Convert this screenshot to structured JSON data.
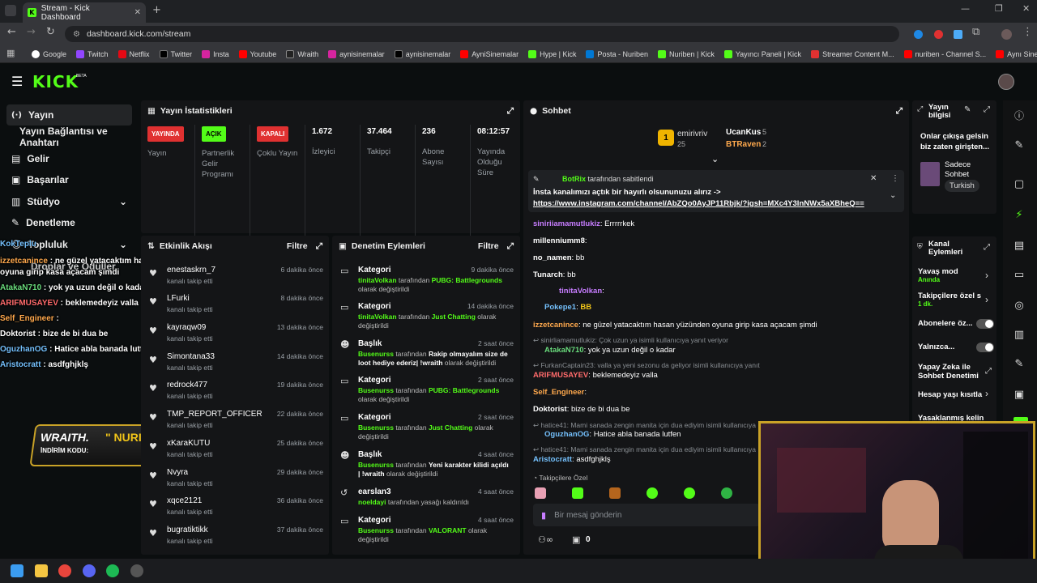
{
  "browser": {
    "tab_title": "Stream - Kick Dashboard",
    "url": "dashboard.kick.com/stream",
    "bookmarks": [
      "Google",
      "Twitch",
      "Netflix",
      "Twitter",
      "Insta",
      "Youtube",
      "Wraith",
      "aynisinemalar",
      "aynisinemalar",
      "AyniSinemalar",
      "Hype | Kick",
      "Posta - Nuriben",
      "Nuriben | Kick",
      "Yayıncı Paneli | Kick",
      "Streamer Content M...",
      "nuriben - Channel S...",
      "Aynı Sinemalar - Ça..."
    ]
  },
  "header": {
    "logo": "KICK",
    "beta": "BETA"
  },
  "sidebar": {
    "items": [
      {
        "label": "Yayın",
        "icon": "broadcast-icon"
      },
      {
        "label": "Yayın Bağlantısı ve Anahtarı"
      },
      {
        "label": "Gelir",
        "icon": "revenue-icon"
      },
      {
        "label": "Başarılar",
        "icon": "trophy-icon"
      },
      {
        "label": "Stüdyo",
        "icon": "studio-icon"
      },
      {
        "label": "Denetleme",
        "icon": "wrench-icon"
      },
      {
        "label": "Topluluk",
        "icon": "community-icon"
      },
      {
        "label": "Droplar ve Ödüller"
      }
    ]
  },
  "stats": {
    "title": "Yayın İstatistikleri",
    "items": [
      {
        "badge": "YAYINDA",
        "label": "Yayın",
        "color": "#e03131"
      },
      {
        "badge": "AÇIK",
        "label": "Partnerlik Gelir Programı",
        "color": "#53fc18"
      },
      {
        "badge": "KAPALI",
        "label": "Çoklu Yayın",
        "color": "#e03131"
      },
      {
        "value": "1.672",
        "label": "İzleyici"
      },
      {
        "value": "37.464",
        "label": "Takipçi"
      },
      {
        "value": "236",
        "label": "Abone Sayısı"
      },
      {
        "value": "08:12:57",
        "label": "Yayında Olduğu Süre"
      }
    ]
  },
  "activity": {
    "title": "Etkinlik Akışı",
    "filter": "Filtre",
    "items": [
      {
        "name": "enestaskrn_7",
        "sub": "kanalı takip etti",
        "time": "6 dakika önce"
      },
      {
        "name": "LFurki",
        "sub": "kanalı takip etti",
        "time": "8 dakika önce"
      },
      {
        "name": "kayraqw09",
        "sub": "kanalı takip etti",
        "time": "13 dakika önce"
      },
      {
        "name": "Simontana33",
        "sub": "kanalı takip etti",
        "time": "14 dakika önce"
      },
      {
        "name": "redrock477",
        "sub": "kanalı takip etti",
        "time": "19 dakika önce"
      },
      {
        "name": "TMP_REPORT_OFFICER",
        "sub": "kanalı takip etti",
        "time": "22 dakika önce"
      },
      {
        "name": "xKaraKUTU",
        "sub": "kanalı takip etti",
        "time": "25 dakika önce"
      },
      {
        "name": "Nvyra",
        "sub": "kanalı takip etti",
        "time": "29 dakika önce"
      },
      {
        "name": "xqce2121",
        "sub": "kanalı takip etti",
        "time": "36 dakika önce"
      },
      {
        "name": "bugratiktikk",
        "sub": "kanalı takip etti",
        "time": "37 dakika önce"
      }
    ]
  },
  "modlog": {
    "title": "Denetim Eylemleri",
    "filter": "Filtre",
    "items": [
      {
        "type": "Kategori",
        "time": "9 dakika önce",
        "who": "tinitaVolkan",
        "mid": "tarafından",
        "val": "PUBG: Battlegrounds",
        "end": "olarak değiştirildi"
      },
      {
        "type": "Kategori",
        "time": "14 dakika önce",
        "who": "tinitaVolkan",
        "mid": "tarafından",
        "val": "Just Chatting",
        "end": "olarak değiştirildi"
      },
      {
        "type": "Başlık",
        "time": "2 saat önce",
        "who": "Busenurss",
        "mid": "tarafından",
        "val": "Rakip olmayalım size de loot hediye ederiz| !wraith",
        "end": "olarak değiştirildi"
      },
      {
        "type": "Kategori",
        "time": "2 saat önce",
        "who": "Busenurss",
        "mid": "tarafından",
        "val": "PUBG: Battlegrounds",
        "end": "olarak değiştirildi"
      },
      {
        "type": "Kategori",
        "time": "2 saat önce",
        "who": "Busenurss",
        "mid": "tarafından",
        "val": "Just Chatting",
        "end": "olarak değiştirildi"
      },
      {
        "type": "Başlık",
        "time": "4 saat önce",
        "who": "Busenurss",
        "mid": "tarafından",
        "val": "Yeni karakter kilidi açıldı | !wraith",
        "end": "olarak değiştirildi"
      },
      {
        "type": "earslan3",
        "time": "4 saat önce",
        "who": "noeldayi",
        "mid": "",
        "val": "",
        "end": "tarafından yasağı kaldırıldı"
      },
      {
        "type": "Kategori",
        "time": "4 saat önce",
        "who": "Busenurss",
        "mid": "tarafından",
        "val": "VALORANT",
        "end": "olarak değiştirildi"
      }
    ]
  },
  "chat": {
    "title": "Sohbet",
    "top": [
      {
        "name": "emirivriv",
        "n": "25",
        "rank": "1"
      },
      {
        "name": "UcanKus",
        "n": "5"
      },
      {
        "name": "BTRaven",
        "n": "2"
      }
    ],
    "pinned_by": "BotRix",
    "pinned_suffix": "tarafından sabitlendi",
    "pinned_text": "İnsta kanalımızı açtık bir hayırlı olsununuzu alırız ->",
    "pinned_link": "https://www.instagram.com/channel/AbZQo0AyJP11Rbjk/?igsh=MXc4Y3lnNWx5aXBheQ==",
    "messages": [
      {
        "user": "siniriiamamutlukiz",
        "text": "Errrrrkek",
        "color": "#c77dff"
      },
      {
        "user": "millenniumm8",
        "text": "",
        "color": "#e6e6e6"
      },
      {
        "user": "no_namen",
        "text": "bb",
        "color": "#e6e6e6"
      },
      {
        "user": "Tunarch",
        "text": "bb",
        "color": "#e6e6e6"
      },
      {
        "user": "tinitaVolkan",
        "text": "",
        "color": "#c77dff"
      },
      {
        "user": "Pokepe1",
        "text": "BB",
        "color": "#74c0fc"
      },
      {
        "user": "izzetcanince",
        "text": "ne güzel yatacaktım hasan yüzünden oyuna girip kasa açacam şimdi",
        "color": "#ffa94d"
      },
      {
        "reply": "sinirliamamutlukiz: Çok uzun ya isimli kullanıcıya yanıt veriyor"
      },
      {
        "user": "AtakaN710",
        "text": "yok ya uzun değil o kadar",
        "color": "#69db7c"
      },
      {
        "reply": "FurkanCaptain23: valla ya yeni sezonu da geliyor isimli kullanıcıya yanıt veriyor"
      },
      {
        "user": "ARIFMUSAYEV",
        "text": "beklemedeyiz valla",
        "color": "#ff6b6b"
      },
      {
        "user": "Self_Engineer",
        "text": "",
        "color": "#ffa94d"
      },
      {
        "user": "Doktorist",
        "text": "bize de bi dua be",
        "color": "#e6e6e6"
      },
      {
        "reply": "hatice41: Mami sanada zengin manita için dua ediyim isimli kullanıcıya"
      },
      {
        "user": "OguzhanOG",
        "text": "Hatice abla banada lutfen",
        "color": "#74c0fc"
      },
      {
        "reply": "hatice41: Mami sanada zengin manita için dua ediyim isimli kullanıcıya"
      },
      {
        "user": "Aristocratt",
        "text": "asdfghjklş",
        "color": "#74c0fc"
      }
    ],
    "followers_only": "Takipçilere Özel",
    "input_placeholder": "Bir mesaj gönderin",
    "count": "0"
  },
  "stream_info": {
    "title": "Yayın bilgisi",
    "desc": "Onlar çıkışa gelsin biz zaten girişten...",
    "category": "Sadece Sohbet",
    "tag": "Turkish"
  },
  "channel_actions": {
    "title": "Kanal Eylemleri",
    "items": [
      {
        "label": "Yavaş mod",
        "sub": "Anında"
      },
      {
        "label": "Takipçilere özel s",
        "sub": "1 dk."
      },
      {
        "label": "Abonelere öz..."
      },
      {
        "label": "Yalnızca..."
      },
      {
        "label": "Yapay Zeka ile Sohbet Denetimi"
      },
      {
        "label": "Hesap yaşı kısıtla"
      },
      {
        "label": "Yasaklanmış kelin"
      }
    ]
  },
  "overlay": {
    "lines": [
      {
        "user": "KokTeplu",
        "text": ""
      },
      {
        "user": "izzetcanince",
        "text": "ne güzel yatacaktım hasan yüzünden oyuna girip kasa açacam şimdi"
      },
      {
        "user": "AtakaN710",
        "text": "yok ya uzun değil o kadar"
      },
      {
        "user": "ARIFMUSAYEV",
        "text": "beklemedeyiz valla"
      },
      {
        "user": "Self_Engineer",
        "text": ""
      },
      {
        "user": "Doktorist",
        "text": "bize de bi dua be"
      },
      {
        "user": "OguzhanOG",
        "text": "Hatice abla banada lutfen"
      },
      {
        "user": "Aristocratt",
        "text": "asdfghjklş"
      }
    ],
    "banner_name": "WRAITH.",
    "banner_code_label": "İNDİRİM KODU:",
    "banner_code": "\" NURI \""
  }
}
